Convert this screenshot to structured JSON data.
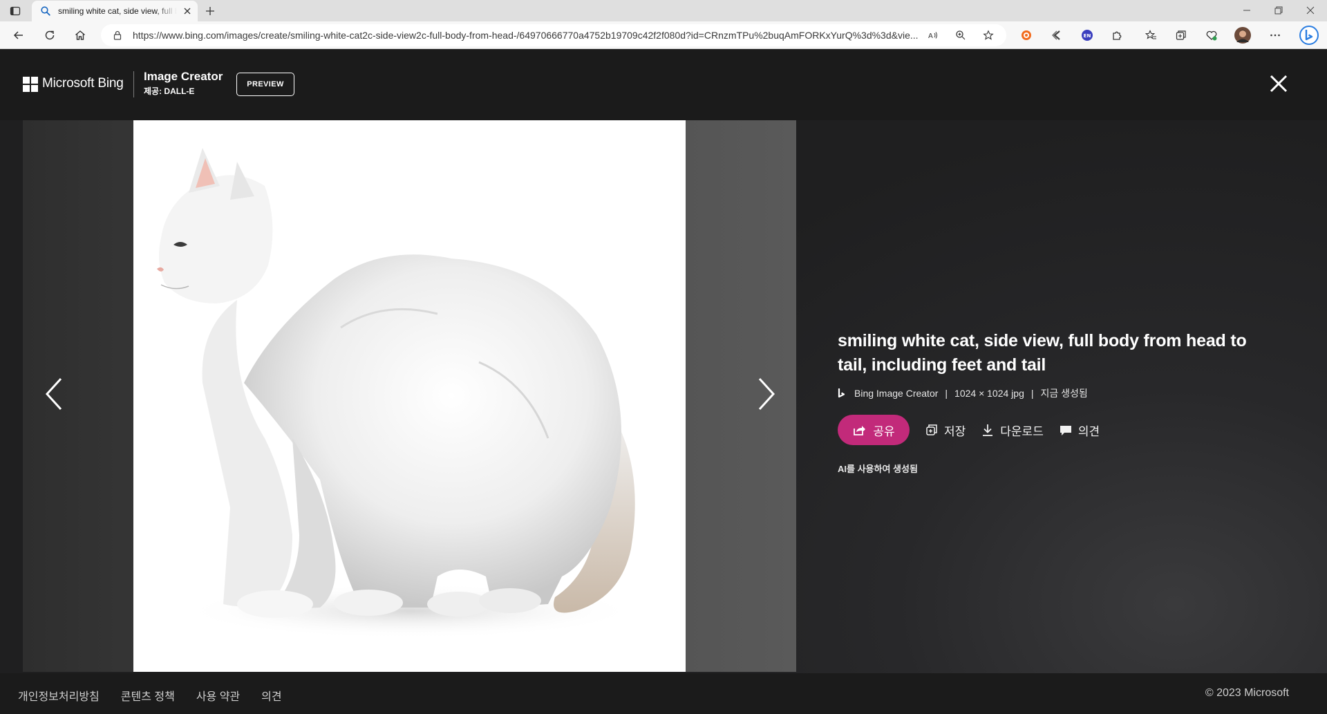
{
  "browser": {
    "tab": {
      "title": "smiling white cat, side view, full body from head to tail"
    },
    "address_bar": {
      "url": "https://www.bing.com/images/create/smiling-white-cat2c-side-view2c-full-body-from-head-/64970666770a4752b19709c42f2f080d?id=CRnzmTPu%2buqAmFORKxYurQ%3d%3d&vie..."
    }
  },
  "header": {
    "brand": "Microsoft Bing",
    "product_title": "Image Creator",
    "product_subtitle": "제공: DALL-E",
    "preview_label": "PREVIEW"
  },
  "viewer": {
    "image_alt": "smiling white cat, side view, full body from head to tail, including feet and tail",
    "title": "smiling white cat, side view, full body from head to tail, including feet and tail",
    "meta": {
      "source": "Bing Image Creator",
      "dimensions": "1024 × 1024 jpg",
      "created": "지금 생성됨"
    },
    "actions": {
      "share": "공유",
      "save": "저장",
      "download": "다운로드",
      "feedback": "의견"
    },
    "ai_note": "AI를 사용하여 생성됨"
  },
  "footer": {
    "links": [
      "개인정보처리방침",
      "콘텐츠 정책",
      "사용 약관",
      "의견"
    ],
    "copyright": "© 2023 Microsoft"
  },
  "colors": {
    "share_accent": "#c22a7a",
    "page_background": "#1b1b1b"
  }
}
